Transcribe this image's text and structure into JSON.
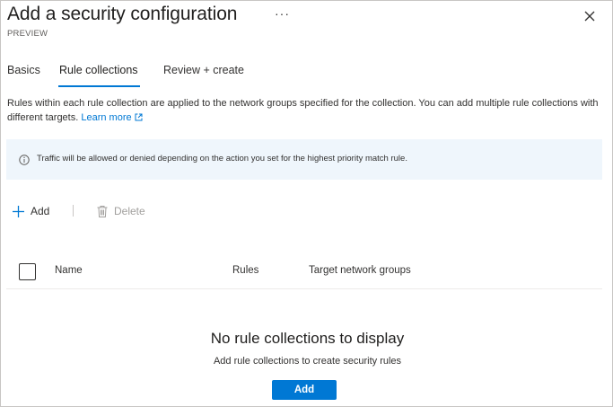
{
  "header": {
    "title": "Add a security configuration",
    "more_label": "···",
    "subtitle": "PREVIEW"
  },
  "tabs": [
    {
      "label": "Basics",
      "active": false
    },
    {
      "label": "Rule collections",
      "active": true
    },
    {
      "label": "Review + create",
      "active": false
    }
  ],
  "description": {
    "text": "Rules within each rule collection are applied to the network groups specified for the collection. You can add multiple rule collections with different targets.",
    "link_label": "Learn more"
  },
  "info": {
    "text": "Traffic will be allowed or denied depending on the action you set for the highest priority match rule."
  },
  "toolbar": {
    "add_label": "Add",
    "delete_label": "Delete"
  },
  "table": {
    "columns": [
      "Name",
      "Rules",
      "Target network groups"
    ]
  },
  "empty_state": {
    "title": "No rule collections to display",
    "subtitle": "Add rule collections to create security rules",
    "button_label": "Add"
  },
  "colors": {
    "accent": "#0078d4",
    "info_background": "#eff6fc",
    "text": "#323130",
    "disabled": "#a19f9d"
  }
}
